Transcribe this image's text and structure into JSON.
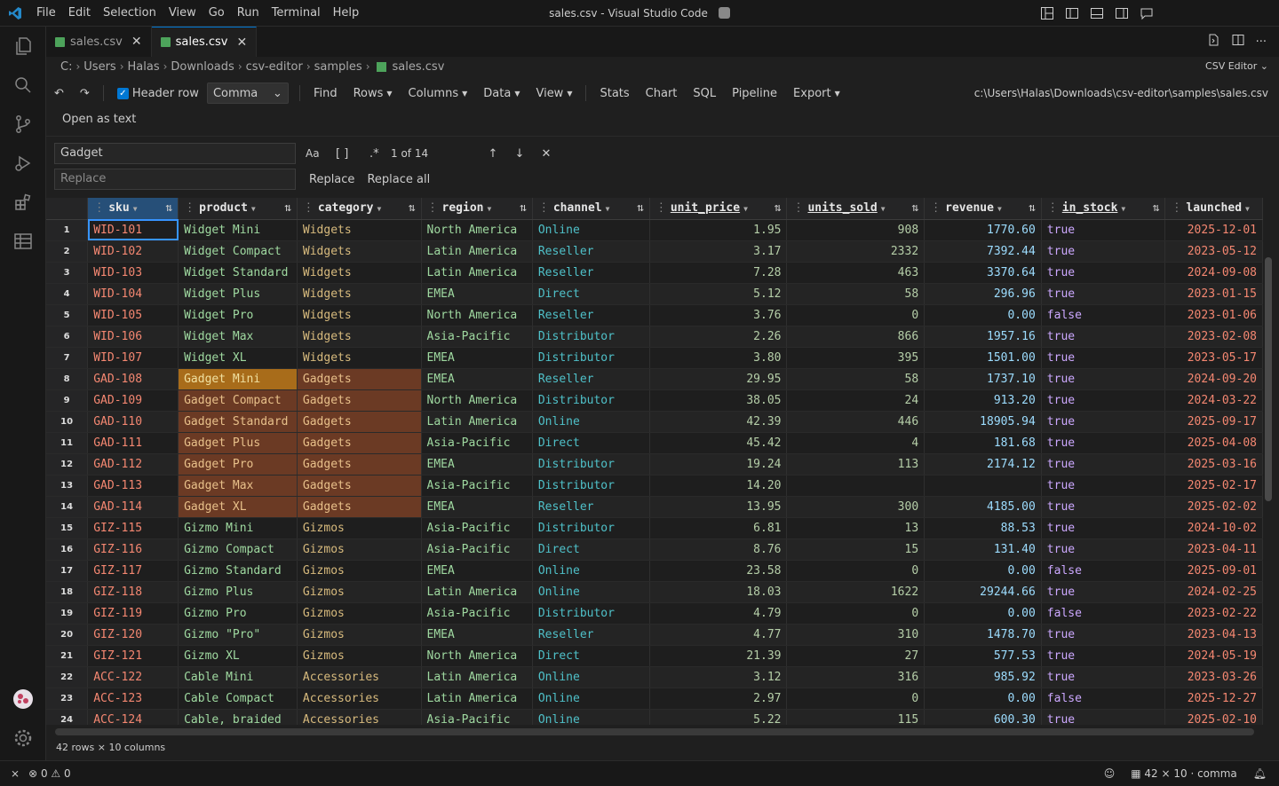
{
  "menu": [
    "File",
    "Edit",
    "Selection",
    "View",
    "Go",
    "Run",
    "Terminal",
    "Help"
  ],
  "window_title": "sales.csv - Visual Studio Code",
  "tabs": [
    {
      "label": "sales.csv",
      "active": false
    },
    {
      "label": "sales.csv",
      "active": true
    }
  ],
  "breadcrumb": [
    "C:",
    "Users",
    "Halas",
    "Downloads",
    "csv-editor",
    "samples",
    "sales.csv"
  ],
  "csv_editor_label": "CSV Editor",
  "toolbar": {
    "header_row_label": "Header row",
    "delimiter": "Comma",
    "find": "Find",
    "rows": "Rows",
    "columns": "Columns",
    "data": "Data",
    "view": "View",
    "stats": "Stats",
    "chart": "Chart",
    "sql": "SQL",
    "pipeline": "Pipeline",
    "export": "Export",
    "file_path": "c:\\Users\\Halas\\Downloads\\csv-editor\\samples\\sales.csv"
  },
  "open_as_text": "Open as text",
  "find": {
    "value": "Gadget",
    "replace_placeholder": "Replace",
    "match_case": "Aa",
    "whole_word": "[ ]",
    "regex": ".*",
    "match_count": "1 of 14",
    "replace_label": "Replace",
    "replace_all_label": "Replace all"
  },
  "columns": [
    "sku",
    "product",
    "category",
    "region",
    "channel",
    "unit_price",
    "units_sold",
    "revenue",
    "in_stock",
    "launched"
  ],
  "rows": [
    [
      "1",
      "WID-101",
      "Widget Mini",
      "Widgets",
      "North America",
      "Online",
      "1.95",
      "908",
      "1770.60",
      "true",
      "2025-12-01"
    ],
    [
      "2",
      "WID-102",
      "Widget Compact",
      "Widgets",
      "Latin America",
      "Reseller",
      "3.17",
      "2332",
      "7392.44",
      "true",
      "2023-05-12"
    ],
    [
      "3",
      "WID-103",
      "Widget Standard",
      "Widgets",
      "Latin America",
      "Reseller",
      "7.28",
      "463",
      "3370.64",
      "true",
      "2024-09-08"
    ],
    [
      "4",
      "WID-104",
      "Widget Plus",
      "Widgets",
      "EMEA",
      "Direct",
      "5.12",
      "58",
      "296.96",
      "true",
      "2023-01-15"
    ],
    [
      "5",
      "WID-105",
      "Widget Pro",
      "Widgets",
      "North America",
      "Reseller",
      "3.76",
      "0",
      "0.00",
      "false",
      "2023-01-06"
    ],
    [
      "6",
      "WID-106",
      "Widget Max",
      "Widgets",
      "Asia-Pacific",
      "Distributor",
      "2.26",
      "866",
      "1957.16",
      "true",
      "2023-02-08"
    ],
    [
      "7",
      "WID-107",
      "Widget XL",
      "Widgets",
      "EMEA",
      "Distributor",
      "3.80",
      "395",
      "1501.00",
      "true",
      "2023-05-17"
    ],
    [
      "8",
      "GAD-108",
      "Gadget Mini",
      "Gadgets",
      "EMEA",
      "Reseller",
      "29.95",
      "58",
      "1737.10",
      "true",
      "2024-09-20"
    ],
    [
      "9",
      "GAD-109",
      "Gadget Compact",
      "Gadgets",
      "North America",
      "Distributor",
      "38.05",
      "24",
      "913.20",
      "true",
      "2024-03-22"
    ],
    [
      "10",
      "GAD-110",
      "Gadget Standard",
      "Gadgets",
      "Latin America",
      "Online",
      "42.39",
      "446",
      "18905.94",
      "true",
      "2025-09-17"
    ],
    [
      "11",
      "GAD-111",
      "Gadget Plus",
      "Gadgets",
      "Asia-Pacific",
      "Direct",
      "45.42",
      "4",
      "181.68",
      "true",
      "2025-04-08"
    ],
    [
      "12",
      "GAD-112",
      "Gadget Pro",
      "Gadgets",
      "EMEA",
      "Distributor",
      "19.24",
      "113",
      "2174.12",
      "true",
      "2025-03-16"
    ],
    [
      "13",
      "GAD-113",
      "Gadget Max",
      "Gadgets",
      "Asia-Pacific",
      "Distributor",
      "14.20",
      "",
      "",
      "true",
      "2025-02-17"
    ],
    [
      "14",
      "GAD-114",
      "Gadget XL",
      "Gadgets",
      "EMEA",
      "Reseller",
      "13.95",
      "300",
      "4185.00",
      "true",
      "2025-02-02"
    ],
    [
      "15",
      "GIZ-115",
      "Gizmo Mini",
      "Gizmos",
      "Asia-Pacific",
      "Distributor",
      "6.81",
      "13",
      "88.53",
      "true",
      "2024-10-02"
    ],
    [
      "16",
      "GIZ-116",
      "Gizmo Compact",
      "Gizmos",
      "Asia-Pacific",
      "Direct",
      "8.76",
      "15",
      "131.40",
      "true",
      "2023-04-11"
    ],
    [
      "17",
      "GIZ-117",
      "Gizmo Standard",
      "Gizmos",
      "EMEA",
      "Online",
      "23.58",
      "0",
      "0.00",
      "false",
      "2025-09-01"
    ],
    [
      "18",
      "GIZ-118",
      "Gizmo Plus",
      "Gizmos",
      "Latin America",
      "Online",
      "18.03",
      "1622",
      "29244.66",
      "true",
      "2024-02-25"
    ],
    [
      "19",
      "GIZ-119",
      "Gizmo Pro",
      "Gizmos",
      "Asia-Pacific",
      "Distributor",
      "4.79",
      "0",
      "0.00",
      "false",
      "2023-02-22"
    ],
    [
      "20",
      "GIZ-120",
      "Gizmo \"Pro\"",
      "Gizmos",
      "EMEA",
      "Reseller",
      "4.77",
      "310",
      "1478.70",
      "true",
      "2023-04-13"
    ],
    [
      "21",
      "GIZ-121",
      "Gizmo XL",
      "Gizmos",
      "North America",
      "Direct",
      "21.39",
      "27",
      "577.53",
      "true",
      "2024-05-19"
    ],
    [
      "22",
      "ACC-122",
      "Cable Mini",
      "Accessories",
      "Latin America",
      "Online",
      "3.12",
      "316",
      "985.92",
      "true",
      "2023-03-26"
    ],
    [
      "23",
      "ACC-123",
      "Cable Compact",
      "Accessories",
      "Latin America",
      "Online",
      "2.97",
      "0",
      "0.00",
      "false",
      "2025-12-27"
    ],
    [
      "24",
      "ACC-124",
      "Cable, braided",
      "Accessories",
      "Asia-Pacific",
      "Online",
      "5.22",
      "115",
      "600.30",
      "true",
      "2025-02-10"
    ]
  ],
  "footer": "42 rows × 10 columns",
  "status": {
    "errors": "0",
    "warnings": "0",
    "grid_info": "42 × 10 · comma"
  },
  "colors": {
    "accent": "#0078d4",
    "match_highlight": "#6b3a24",
    "current_match": "#a86c1a"
  }
}
